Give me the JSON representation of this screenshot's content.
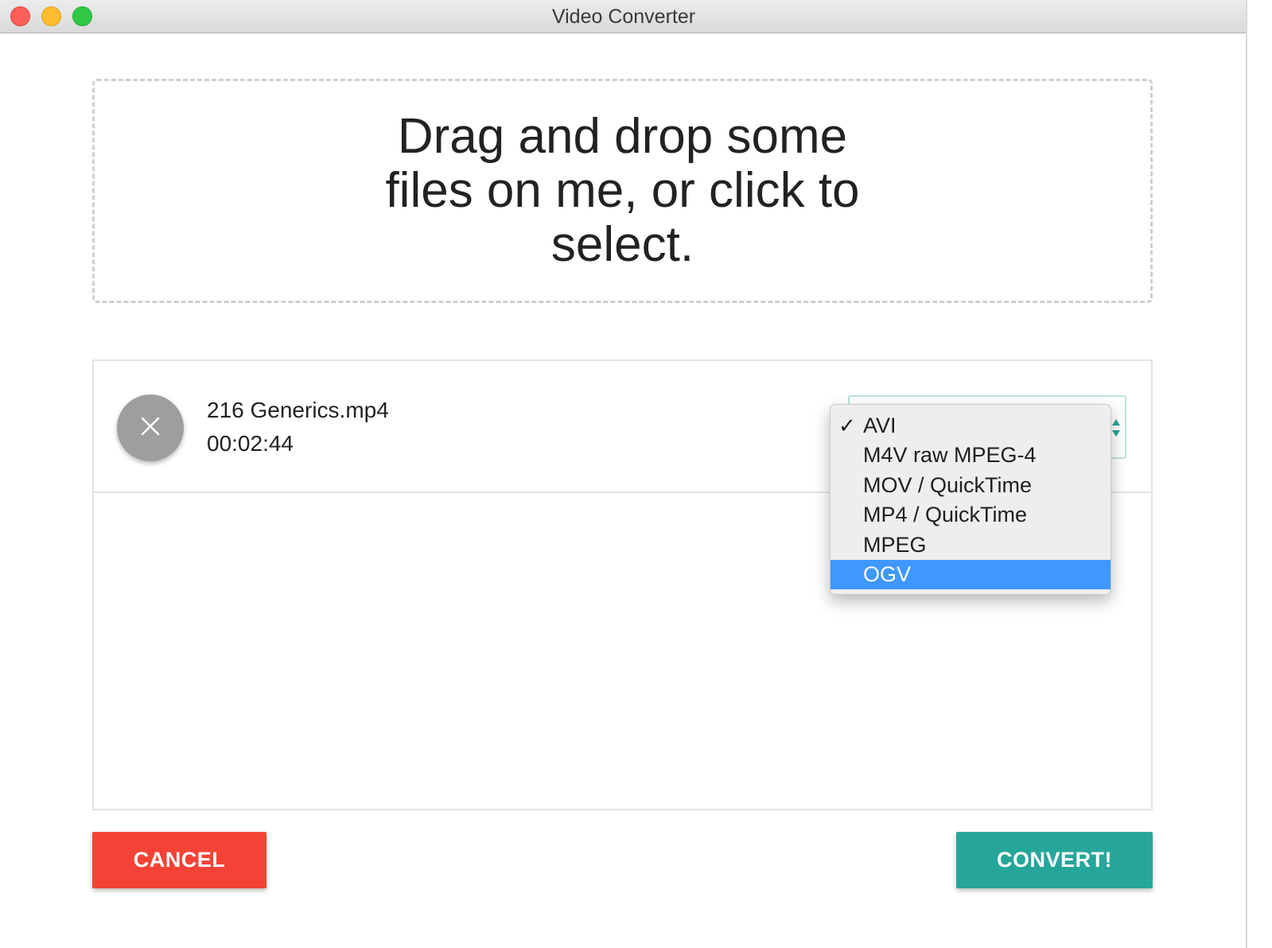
{
  "window": {
    "title": "Video Converter"
  },
  "dropzone": {
    "text": "Drag and drop some files on me, or click to select."
  },
  "file": {
    "name": "216 Generics.mp4",
    "duration": "00:02:44"
  },
  "format_menu": {
    "checked": "AVI",
    "highlighted": "OGV",
    "options": [
      "AVI",
      "M4V raw MPEG-4",
      "MOV / QuickTime",
      "MP4 / QuickTime",
      "MPEG",
      "OGV"
    ]
  },
  "buttons": {
    "cancel": "CANCEL",
    "convert": "CONVERT!"
  },
  "colors": {
    "cancel": "#f44336",
    "convert": "#26a69a",
    "menu_highlight": "#3e98ff",
    "remove_button": "#9e9e9e"
  },
  "icons": {
    "remove": "close-icon",
    "checked": "checkmark-icon",
    "select_arrows": "up-down-arrows-icon"
  }
}
